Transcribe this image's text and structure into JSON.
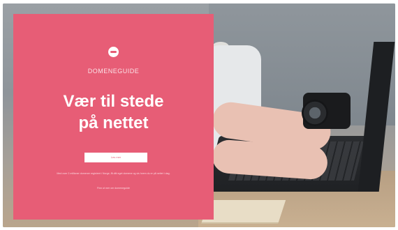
{
  "card": {
    "brand": "DOMENEGUIDE",
    "headline_line1": "Vær til stede",
    "headline_line2": "på nettet",
    "cta_label": "Les mer",
    "description": "Med over 2 millioner domener registrert i Norge, få ditt eget domene og vis hvem du er på nettet i dag.",
    "small_link": "Finn ut mer om domeneguide",
    "accent_color": "#e75d76"
  },
  "background": {
    "icons": [
      "laptop",
      "camera",
      "hands-typing",
      "book"
    ]
  }
}
